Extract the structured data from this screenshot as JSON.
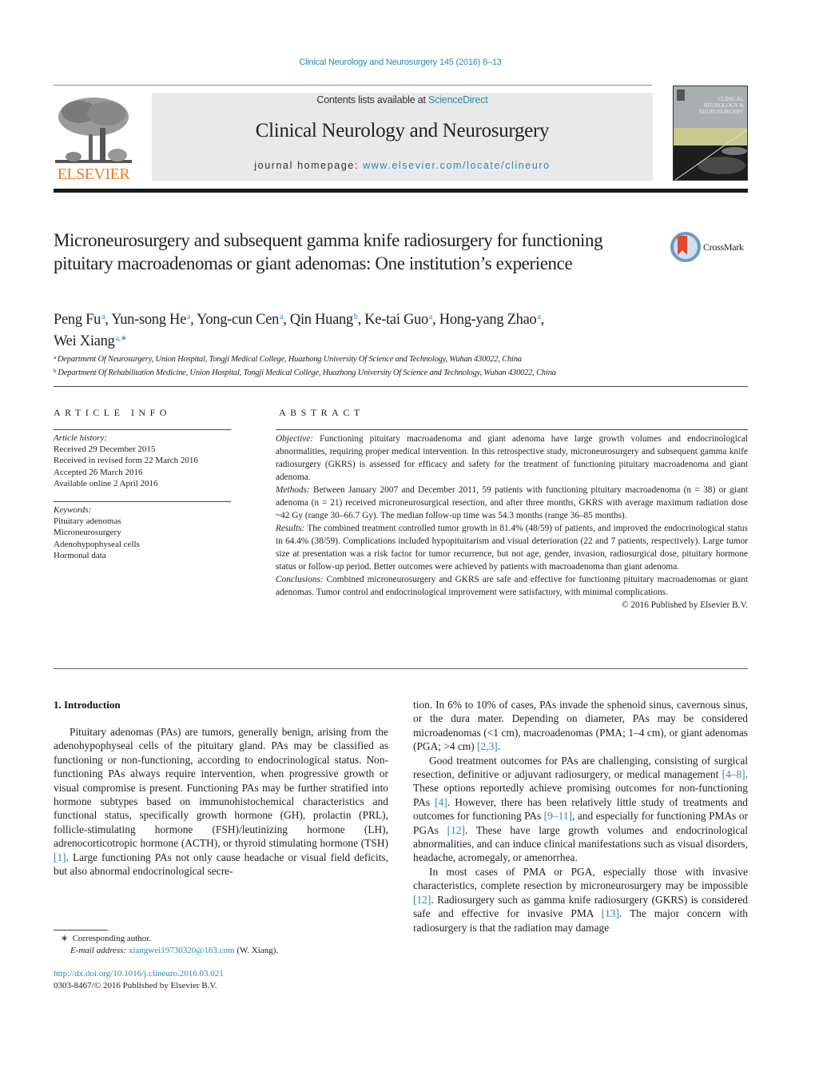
{
  "header": {
    "running_head": "Clinical Neurology and Neurosurgery 145 (2016) 8–13",
    "publisher_logo_text": "ELSEVIER",
    "contents_prefix": "Contents lists available at ",
    "contents_link": "ScienceDirect",
    "journal_title": "Clinical Neurology and Neurosurgery",
    "homepage_prefix": "journal homepage: ",
    "homepage_link": "www.elsevier.com/locate/clineuro",
    "cover_title_lines": [
      "CLINICAL",
      "NEUROLOGY &",
      "NEUROSURGERY"
    ],
    "crossmark_label": "CrossMark"
  },
  "article": {
    "title": "Microneurosurgery and subsequent gamma knife radiosurgery for functioning pituitary macroadenomas or giant adenomas: One institution’s experience",
    "authors": [
      {
        "name": "Peng Fu",
        "aff": "a"
      },
      {
        "name": "Yun-song He",
        "aff": "a"
      },
      {
        "name": "Yong-cun Cen",
        "aff": "a"
      },
      {
        "name": "Qin Huang",
        "aff": "b"
      },
      {
        "name": "Ke-tai Guo",
        "aff": "a"
      },
      {
        "name": "Hong-yang Zhao",
        "aff": "a"
      },
      {
        "name": "Wei Xiang",
        "aff": "a,∗"
      }
    ],
    "affiliations": [
      {
        "mark": "a",
        "text": "Department Of Neurosurgery, Union Hospital, Tongji Medical College, Huazhong University Of Science and Technology, Wuhan 430022, China"
      },
      {
        "mark": "b",
        "text": "Department Of Rehabilitation Medicine, Union Hospital, Tongji Medical College, Huazhong University Of Science and Technology, Wuhan 430022, China"
      }
    ]
  },
  "article_info": {
    "heading": "ARTICLE INFO",
    "history_label": "Article history:",
    "history": [
      "Received 29 December 2015",
      "Received in revised form 22 March 2016",
      "Accepted 26 March 2016",
      "Available online 2 April 2016"
    ],
    "keywords_label": "Keywords:",
    "keywords": [
      "Pituitary adenomas",
      "Microneurosurgery",
      "Adenohypophyseal cells",
      "Hormonal data"
    ]
  },
  "abstract": {
    "heading": "ABSTRACT",
    "sections": [
      {
        "label": "Objective:",
        "text": " Functioning pituitary macroadenoma and giant adenoma have large growth volumes and endocrinological abnormalities, requiring proper medical intervention. In this retrospective study, microneurosurgery and subsequent gamma knife radiosurgery (GKRS) is assessed for efficacy and safety for the treatment of functioning pituitary macroadenoma and giant adenoma."
      },
      {
        "label": "Methods:",
        "text": " Between January 2007 and December 2011, 59 patients with functioning pituitary macroade­noma (n = 38) or giant adenoma (n = 21) received microneurosurgical resection, and after three months, GKRS with average maximum radiation dose ~42 Gy (range 30–66.7 Gy). The median follow-up time was 54.3 months (range 36–85 months)."
      },
      {
        "label": "Results:",
        "text": " The combined treatment controlled tumor growth in 81.4% (48/59) of patients, and improved the endocrinological status in 64.4% (38/59). Complications included hypopituitarism and visual deteri­oration (22 and 7 patients, respectively). Large tumor size at presentation was a risk factor for tumor recurrence, but not age, gender, invasion, radiosurgical dose, pituitary hormone status or follow-up period. Better outcomes were achieved by patients with macroadenoma than giant adenoma."
      },
      {
        "label": "Conclusions:",
        "text": " Combined microneurosurgery and GKRS are safe and effective for functioning pituitary macroadenomas or giant adenomas. Tumor control and endocrinological improvement were satisfactory, with minimal complications."
      }
    ],
    "copyright": "© 2016 Published by Elsevier B.V."
  },
  "introduction": {
    "heading": "1.  Introduction",
    "left_paragraphs": [
      [
        {
          "t": "Pituitary adenomas (PAs) are tumors, generally benign, aris­ing from the adenohypophyseal cells of the pituitary gland. PAs may be classified as functioning or non-functioning, according to endocrinological status. Non-functioning PAs always require intervention, when progressive growth or visual compromise is present. Functioning PAs may be further stratified into hor­mone subtypes based on immunohistochemical characteristics and functional status, specifically growth hormone (GH), prolactin (PRL), follicle-stimulating hormone (FSH)/leutinizing hormone (LH), adrenocorticotropic hormone (ACTH), or thyroid stimulating hormone (TSH) "
        },
        {
          "ref": "[1]"
        },
        {
          "t": ". Large functioning PAs not only cause headache or visual field deficits, but also abnormal endocrinological secre-"
        }
      ]
    ],
    "right_paragraphs": [
      [
        {
          "t": "tion. In 6% to 10% of cases, PAs invade the sphenoid sinus, cavernous sinus, or the dura mater. Depending on diameter, PAs may be con­sidered microadenomas (<1 cm), macroadenomas (PMA; 1–4 cm), or giant adenomas (PGA; >4 cm) "
        },
        {
          "ref": "[2,3]"
        },
        {
          "t": "."
        }
      ],
      [
        {
          "t": "Good treatment outcomes for PAs are challenging, consisting of surgical resection, definitive or adjuvant radiosurgery, or medical management "
        },
        {
          "ref": "[4–8]"
        },
        {
          "t": ". These options reportedly achieve promising outcomes for non-functioning PAs "
        },
        {
          "ref": "[4]"
        },
        {
          "t": ". However, there has been relatively little study of treatments and outcomes for function­ing PAs "
        },
        {
          "ref": "[9–11]"
        },
        {
          "t": ", and especially for functioning PMAs or PGAs "
        },
        {
          "ref": "[12]"
        },
        {
          "t": ". These have large growth volumes and endocrinological abnormali­ties, and can induce clinical manifestations such as visual disorders, headache, acromegaly, or amenorrhea."
        }
      ],
      [
        {
          "t": "In most cases of PMA or PGA, especially those with invasive characteristics, complete resection by microneurosurgery may be impossible "
        },
        {
          "ref": "[12]"
        },
        {
          "t": ". Radiosurgery such as gamma knife radiosurgery (GKRS) is considered safe and effective for invasive PMA "
        },
        {
          "ref": "[13]"
        },
        {
          "t": ". The major concern with radiosurgery is that the radiation may damage"
        }
      ]
    ]
  },
  "footnotes": {
    "corresponding_mark": "∗",
    "corresponding_text": "Corresponding author.",
    "email_label": "E-mail address:",
    "email": "xiangwei19730320@163.com",
    "email_suffix": " (W. Xiang).",
    "doi_link": "http://dx.doi.org/10.1016/j.clineuro.2016.03.021",
    "issn_line": "0303-8467/© 2016 Published by Elsevier B.V."
  },
  "colors": {
    "link": "#2a8ab0",
    "elsevier_orange": "#f07b1e",
    "masthead_bg": "#e9e9e9"
  }
}
